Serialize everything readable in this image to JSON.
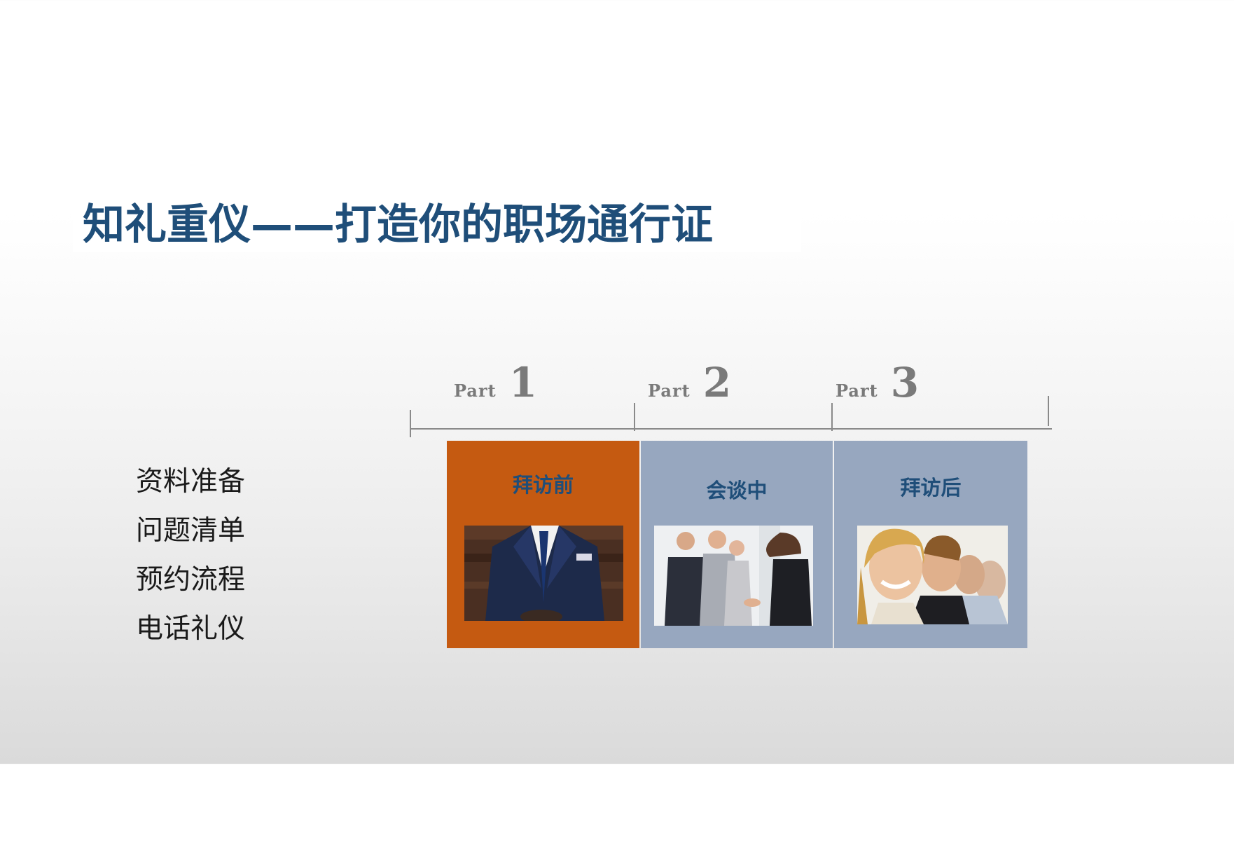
{
  "title": "知礼重仪——打造你的职场通行证",
  "list": [
    "资料准备",
    "问题清单",
    "预约流程",
    "电话礼仪"
  ],
  "parts": [
    {
      "word": "Part",
      "number": "1"
    },
    {
      "word": "Part",
      "number": "2"
    },
    {
      "word": "Part",
      "number": "3"
    }
  ],
  "panels": [
    {
      "label": "拜访前",
      "photo": "businessman-suit-photo"
    },
    {
      "label": "会谈中",
      "photo": "business-handshake-photo"
    },
    {
      "label": "拜访后",
      "photo": "smiling-group-photo"
    }
  ],
  "colors": {
    "title": "#1f4e79",
    "panel_active": "#c55a11",
    "panel_inactive": "#97a7bf",
    "part_text": "#7a7a7a"
  }
}
